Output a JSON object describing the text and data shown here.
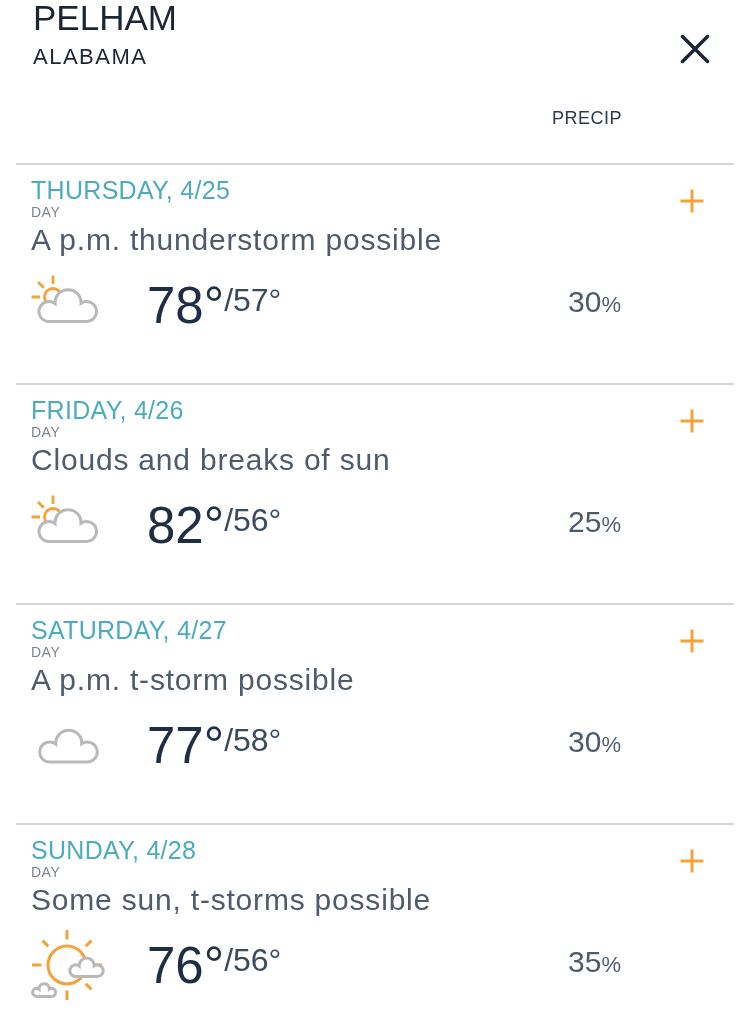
{
  "location": {
    "city": "PELHAM",
    "state": "ALABAMA"
  },
  "columns": {
    "precip": "PRECIP"
  },
  "days": [
    {
      "date": "THURSDAY, 4/25",
      "period": "DAY",
      "phrase": "A p.m. thunderstorm possible",
      "kind": "partly_sunny",
      "high": "78°",
      "low": "/57°",
      "precip": "30%",
      "expanded": false
    },
    {
      "date": "FRIDAY, 4/26",
      "period": "DAY",
      "phrase": "Clouds and breaks of sun",
      "kind": "partly_sunny",
      "high": "82°",
      "low": "/56°",
      "precip": "25%",
      "expanded": false
    },
    {
      "date": "SATURDAY, 4/27",
      "period": "DAY",
      "phrase": "A p.m. t-storm possible",
      "kind": "cloudy",
      "high": "77°",
      "low": "/58°",
      "precip": "30%",
      "expanded": false
    },
    {
      "date": "SUNDAY, 4/28",
      "period": "DAY",
      "phrase": "Some sun, t-storms possible",
      "kind": "sun_and_clouds",
      "high": "76°",
      "low": "/56°",
      "precip": "35%",
      "expanded": false
    }
  ]
}
